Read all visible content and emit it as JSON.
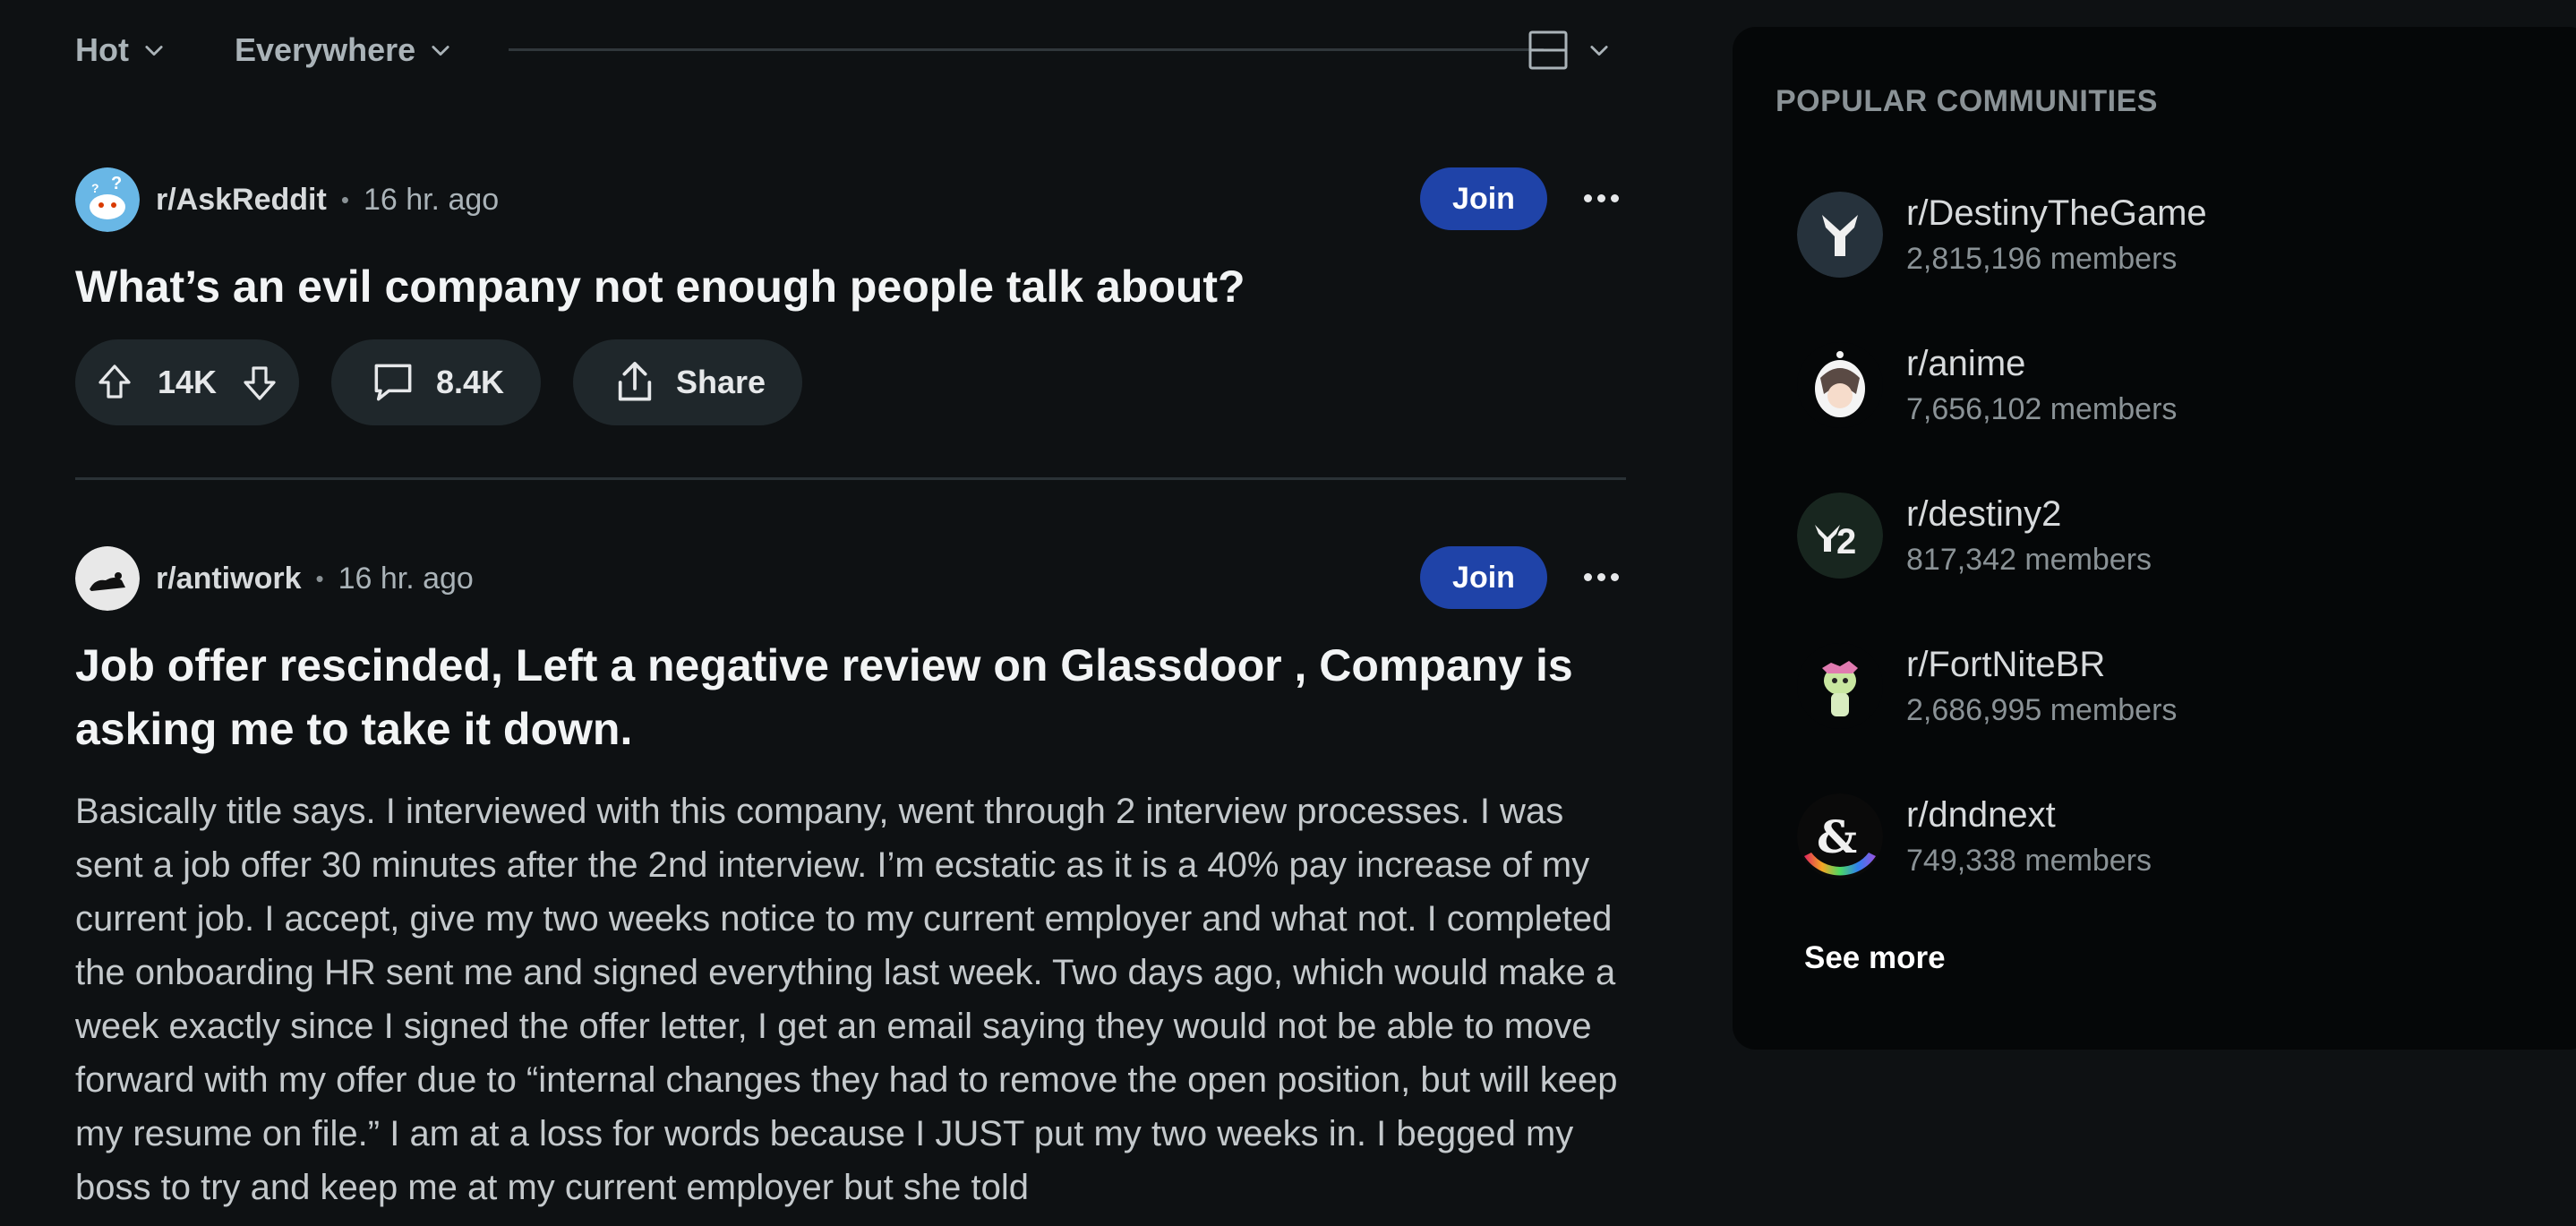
{
  "sort": {
    "primary_label": "Hot",
    "location_label": "Everywhere",
    "layout_icon": "card-layout-icon"
  },
  "posts": [
    {
      "subreddit": "r/AskReddit",
      "separator": "•",
      "time": "16 hr. ago",
      "join_label": "Join",
      "title": "What’s an evil company not enough people talk about?",
      "votes": "14K",
      "comments": "8.4K",
      "share_label": "Share"
    },
    {
      "subreddit": "r/antiwork",
      "separator": "•",
      "time": "16 hr. ago",
      "join_label": "Join",
      "title": "Job offer rescinded, Left a negative review on Glassdoor , Company is asking me to take it down.",
      "body": "Basically title says. I interviewed with this company, went through 2 interview processes. I was sent a job offer 30 minutes after the 2nd interview. I’m ecstatic as it is a 40% pay increase of my current job. I accept, give my two weeks notice to my current employer and what not. I completed the onboarding HR sent me and signed everything last week. Two days ago, which would make a week exactly since I signed the offer letter, I get an email saying they would not be able to move forward with my offer due to “internal changes they had to remove the open position, but will keep my resume on file.” I am at a loss for words because I JUST put my two weeks in. I begged my boss to try and keep me at my current employer but she told"
    }
  ],
  "sidebar": {
    "title": "POPULAR COMMUNITIES",
    "communities": [
      {
        "name": "r/DestinyTheGame",
        "members": "2,815,196 members"
      },
      {
        "name": "r/anime",
        "members": "7,656,102 members"
      },
      {
        "name": "r/destiny2",
        "members": "817,342 members"
      },
      {
        "name": "r/FortNiteBR",
        "members": "2,686,995 members"
      },
      {
        "name": "r/dndnext",
        "members": "749,338 members"
      }
    ],
    "see_more_label": "See more"
  },
  "colors": {
    "background": "#0e1113",
    "join_button": "#1f43a8",
    "pill": "#1f272b",
    "sidebar": "#050708"
  }
}
